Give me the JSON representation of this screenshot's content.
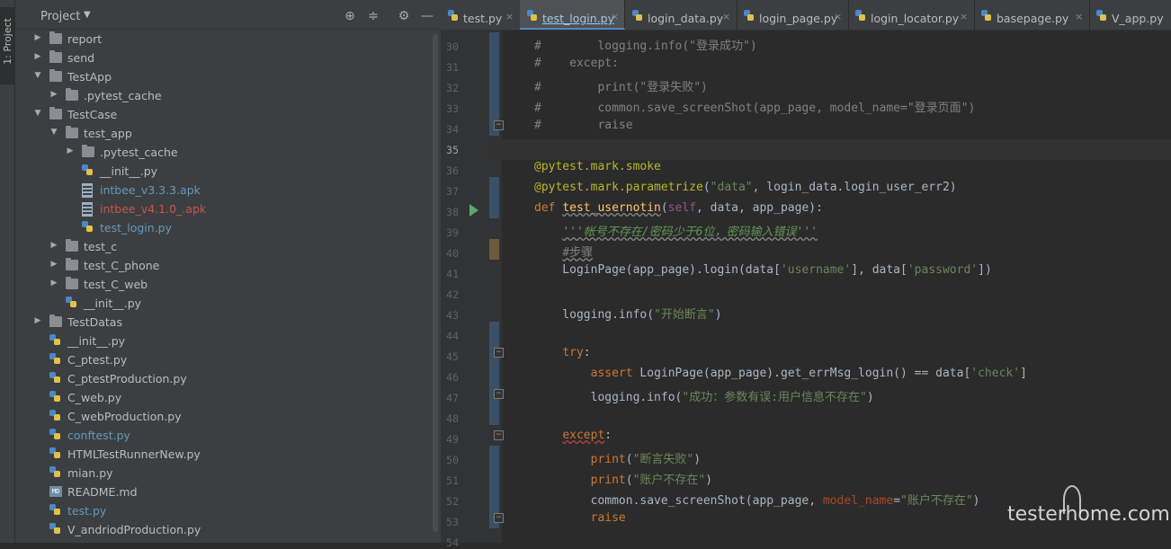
{
  "sidebar": {
    "tab_label": "1: Project"
  },
  "panel": {
    "title": "Project",
    "header_icons": [
      "locate-icon",
      "collapse-icon",
      "gear-icon",
      "minimize-icon"
    ],
    "tree": [
      {
        "label": "report",
        "type": "folder",
        "expanded": false,
        "depth": 0
      },
      {
        "label": "send",
        "type": "folder",
        "expanded": false,
        "depth": 0
      },
      {
        "label": "TestApp",
        "type": "folder",
        "expanded": true,
        "depth": 0
      },
      {
        "label": ".pytest_cache",
        "type": "folder",
        "expanded": false,
        "depth": 1
      },
      {
        "label": "TestCase",
        "type": "folder",
        "expanded": true,
        "depth": 0
      },
      {
        "label": "test_app",
        "type": "folder",
        "expanded": true,
        "depth": 1
      },
      {
        "label": ".pytest_cache",
        "type": "folder",
        "expanded": false,
        "depth": 2
      },
      {
        "label": "__init__.py",
        "type": "py",
        "depth": 2
      },
      {
        "label": "intbee_v3.3.3.apk",
        "type": "apk",
        "depth": 2,
        "color": "#6897bb"
      },
      {
        "label": "intbee_v4.1.0_.apk",
        "type": "apk",
        "depth": 2,
        "color": "#c75450"
      },
      {
        "label": "test_login.py",
        "type": "py",
        "depth": 2,
        "color": "#6897bb"
      },
      {
        "label": "test_c",
        "type": "folder",
        "expanded": false,
        "depth": 1
      },
      {
        "label": "test_C_phone",
        "type": "folder",
        "expanded": false,
        "depth": 1
      },
      {
        "label": "test_C_web",
        "type": "folder",
        "expanded": false,
        "depth": 1
      },
      {
        "label": "__init__.py",
        "type": "py",
        "depth": 1
      },
      {
        "label": "TestDatas",
        "type": "folder",
        "expanded": false,
        "depth": 0
      },
      {
        "label": "__init__.py",
        "type": "py",
        "depth": 0
      },
      {
        "label": "C_ptest.py",
        "type": "py",
        "depth": 0
      },
      {
        "label": "C_ptestProduction.py",
        "type": "py",
        "depth": 0
      },
      {
        "label": "C_web.py",
        "type": "py",
        "depth": 0
      },
      {
        "label": "C_webProduction.py",
        "type": "py",
        "depth": 0
      },
      {
        "label": "conftest.py",
        "type": "py",
        "depth": 0,
        "color": "#6897bb"
      },
      {
        "label": "HTMLTestRunnerNew.py",
        "type": "py",
        "depth": 0
      },
      {
        "label": "mian.py",
        "type": "py",
        "depth": 0
      },
      {
        "label": "README.md",
        "type": "md",
        "depth": 0
      },
      {
        "label": "test.py",
        "type": "py",
        "depth": 0,
        "color": "#6897bb"
      },
      {
        "label": "V_andriodProduction.py",
        "type": "py",
        "depth": 0
      }
    ]
  },
  "tabs": [
    {
      "label": "test.py",
      "active": false
    },
    {
      "label": "test_login.py",
      "active": true
    },
    {
      "label": "login_data.py",
      "active": false
    },
    {
      "label": "login_page.py",
      "active": false
    },
    {
      "label": "login_locator.py",
      "active": false
    },
    {
      "label": "basepage.py",
      "active": false
    },
    {
      "label": "V_app.py",
      "active": false
    }
  ],
  "code": [
    {
      "n": "30",
      "tokens": [
        [
          "com",
          "#        logging.info(\"登录成功\")"
        ]
      ]
    },
    {
      "n": "31",
      "tokens": [
        [
          "com",
          "#    except:"
        ]
      ]
    },
    {
      "n": "32",
      "tokens": [
        [
          "com",
          "#        print(\"登录失败\")"
        ]
      ]
    },
    {
      "n": "33",
      "tokens": [
        [
          "com",
          "#        common.save_screenShot(app_page, model_name=\"登录页面\")"
        ]
      ]
    },
    {
      "n": "34",
      "tokens": [
        [
          "com",
          "#        raise"
        ]
      ]
    },
    {
      "n": "35",
      "tokens": []
    },
    {
      "n": "36",
      "tokens": [
        [
          "dec",
          "@pytest.mark.smoke"
        ]
      ]
    },
    {
      "n": "37",
      "tokens": [
        [
          "dec",
          "@pytest.mark.parametrize"
        ],
        [
          "plain",
          "("
        ],
        [
          "str",
          "\"data\""
        ],
        [
          "plain",
          ", login_data.login_user_err2)"
        ]
      ]
    },
    {
      "n": "38",
      "tokens": [
        [
          "kw",
          "def "
        ],
        [
          "fn",
          "test_usernotin"
        ],
        [
          "plain",
          "("
        ],
        [
          "self",
          "self"
        ],
        [
          "plain",
          ", data, app_page):"
        ]
      ]
    },
    {
      "n": "39",
      "tokens": [
        [
          "plain",
          "    "
        ],
        [
          "doc",
          "'''帐号不存在/密码少于6位，密码输入错误'''"
        ]
      ]
    },
    {
      "n": "40",
      "tokens": [
        [
          "plain",
          "    "
        ],
        [
          "comul",
          "#步骤"
        ]
      ]
    },
    {
      "n": "41",
      "tokens": [
        [
          "plain",
          "    LoginPage(app_page).login(data["
        ],
        [
          "str",
          "'username'"
        ],
        [
          "plain",
          "], data["
        ],
        [
          "str",
          "'password'"
        ],
        [
          "plain",
          "])"
        ]
      ]
    },
    {
      "n": "42",
      "tokens": []
    },
    {
      "n": "43",
      "tokens": [
        [
          "plain",
          "    logging.info("
        ],
        [
          "str",
          "\"开始断言\""
        ],
        [
          "plain",
          ")"
        ]
      ]
    },
    {
      "n": "44",
      "tokens": []
    },
    {
      "n": "45",
      "tokens": [
        [
          "plain",
          "    "
        ],
        [
          "kw",
          "try"
        ],
        [
          "plain",
          ":"
        ]
      ]
    },
    {
      "n": "46",
      "tokens": [
        [
          "plain",
          "        "
        ],
        [
          "kw",
          "assert "
        ],
        [
          "plain",
          "LoginPage(app_page).get_errMsg_login() == data["
        ],
        [
          "str",
          "'check'"
        ],
        [
          "plain",
          "]"
        ]
      ]
    },
    {
      "n": "47",
      "tokens": [
        [
          "plain",
          "        logging.info("
        ],
        [
          "str",
          "\"成功：参数有误:用户信息不存在\""
        ],
        [
          "plain",
          ")"
        ]
      ]
    },
    {
      "n": "48",
      "tokens": []
    },
    {
      "n": "49",
      "tokens": [
        [
          "plain",
          "    "
        ],
        [
          "kwul",
          "except"
        ],
        [
          "plain",
          ":"
        ]
      ]
    },
    {
      "n": "50",
      "tokens": [
        [
          "plain",
          "        "
        ],
        [
          "kw",
          "print"
        ],
        [
          "plain",
          "("
        ],
        [
          "str",
          "\"断言失败\""
        ],
        [
          "plain",
          ")"
        ]
      ]
    },
    {
      "n": "51",
      "tokens": [
        [
          "plain",
          "        "
        ],
        [
          "kw",
          "print"
        ],
        [
          "plain",
          "("
        ],
        [
          "str",
          "\"账户不存在\""
        ],
        [
          "plain",
          ")"
        ]
      ]
    },
    {
      "n": "52",
      "tokens": [
        [
          "plain",
          "        common.save_screenShot(app_page, "
        ],
        [
          "param",
          "model_name"
        ],
        [
          "plain",
          "="
        ],
        [
          "str",
          "\"账户不存在\""
        ],
        [
          "plain",
          ")"
        ]
      ]
    },
    {
      "n": "53",
      "tokens": [
        [
          "plain",
          "        "
        ],
        [
          "kw",
          "raise"
        ]
      ]
    },
    {
      "n": "54",
      "tokens": []
    }
  ],
  "watermark": "testerhome.com"
}
